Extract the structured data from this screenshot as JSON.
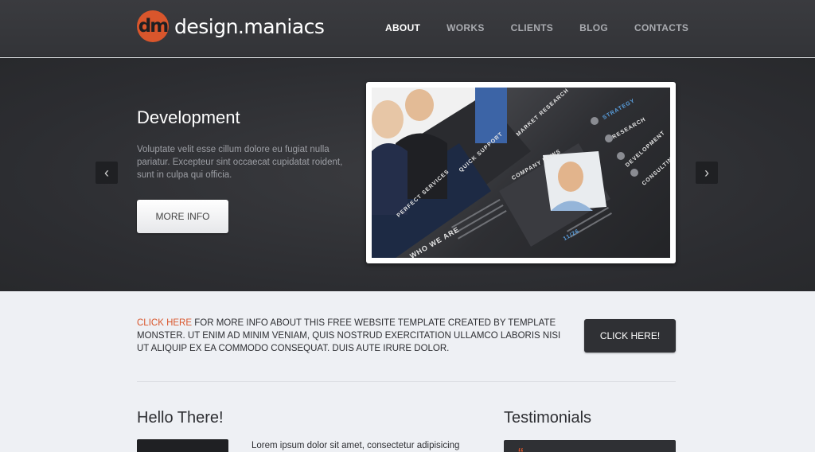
{
  "brand": {
    "logo_mark": "dm",
    "name": "design.maniacs"
  },
  "nav": {
    "items": [
      {
        "label": "ABOUT",
        "active": true
      },
      {
        "label": "WORKS",
        "active": false
      },
      {
        "label": "CLIENTS",
        "active": false
      },
      {
        "label": "BLOG",
        "active": false
      },
      {
        "label": "CONTACTS",
        "active": false
      }
    ]
  },
  "hero": {
    "title": "Development",
    "text": "Voluptate velit esse cillum dolore eu fugiat nulla pariatur. Excepteur sint occaecat cupidatat roident, sunt in culpa qui officia.",
    "button": "MORE INFO",
    "prev_icon": "chevron-left-icon",
    "next_icon": "chevron-right-icon",
    "slide": {
      "tiles": [
        "MARKET RESEARCH",
        "QUICK SUPPORT",
        "PERFECT SERVICES",
        "COMPANY NEWS",
        "WHO WE ARE"
      ],
      "menu": [
        "STRATEGY",
        "RESEARCH",
        "DEVELOPMENT",
        "CONSULTING"
      ],
      "date": "11/26"
    }
  },
  "info": {
    "link": "CLICK HERE",
    "text": " FOR MORE INFO ABOUT THIS FREE WEBSITE TEMPLATE CREATED BY TEMPLATE MONSTER. UT ENIM AD MINIM VENIAM, QUIS NOSTRUD EXERCITATION ULLAMCO LABORIS NISI UT ALIQUIP EX EA COMMODO CONSEQUAT. DUIS AUTE IRURE DOLOR.",
    "button": "CLICK HERE!"
  },
  "hello": {
    "title": "Hello There!",
    "text": "Lorem ipsum dolor sit amet, consectetur adipisicing"
  },
  "testimonials": {
    "title": "Testimonials",
    "quote_icon": "quote-icon"
  },
  "colors": {
    "accent": "#d9562c",
    "header_bg": "#37383c",
    "hero_bg": "#2f3034",
    "page_bg": "#eef0f4"
  }
}
